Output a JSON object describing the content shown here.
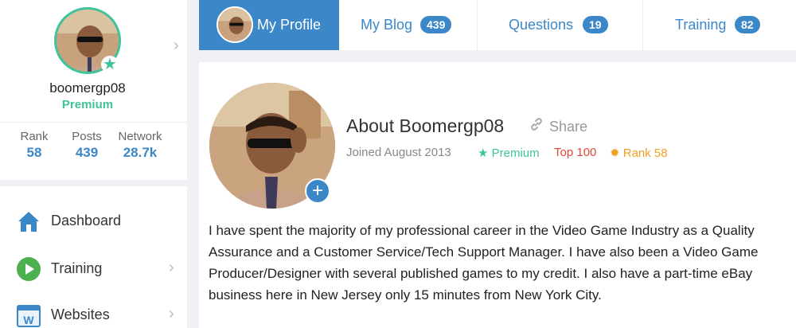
{
  "profile": {
    "username": "boomergp08",
    "membership": "Premium",
    "stats": [
      {
        "label": "Rank",
        "value": "58"
      },
      {
        "label": "Posts",
        "value": "439"
      },
      {
        "label": "Network",
        "value": "28.7k"
      }
    ]
  },
  "nav": {
    "items": [
      {
        "label": "Dashboard",
        "icon": "home-icon"
      },
      {
        "label": "Training",
        "icon": "play-icon"
      },
      {
        "label": "Websites",
        "icon": "websites-icon"
      }
    ]
  },
  "tabs": [
    {
      "label": "My Profile"
    },
    {
      "label": "My Blog",
      "badge": "439"
    },
    {
      "label": "Questions",
      "badge": "19"
    },
    {
      "label": "Training",
      "badge": "82"
    }
  ],
  "about": {
    "title": "About Boomergp08",
    "share": "Share",
    "joined": "Joined August 2013",
    "premium": "Premium",
    "top": "Top 100",
    "rank": "Rank 58",
    "bio": "I have spent the majority of my professional career in the Video Game Industry as a Quality Assurance and a Customer Service/Tech Support Manager. I have also been a Video Game Producer/Designer with several published games to my credit. I also have a part-time eBay business here in New Jersey only 15 minutes from New York City."
  },
  "colors": {
    "accent": "#3b87c8",
    "premium": "#3fc39a",
    "top": "#e2473e",
    "rank": "#f0a020"
  }
}
